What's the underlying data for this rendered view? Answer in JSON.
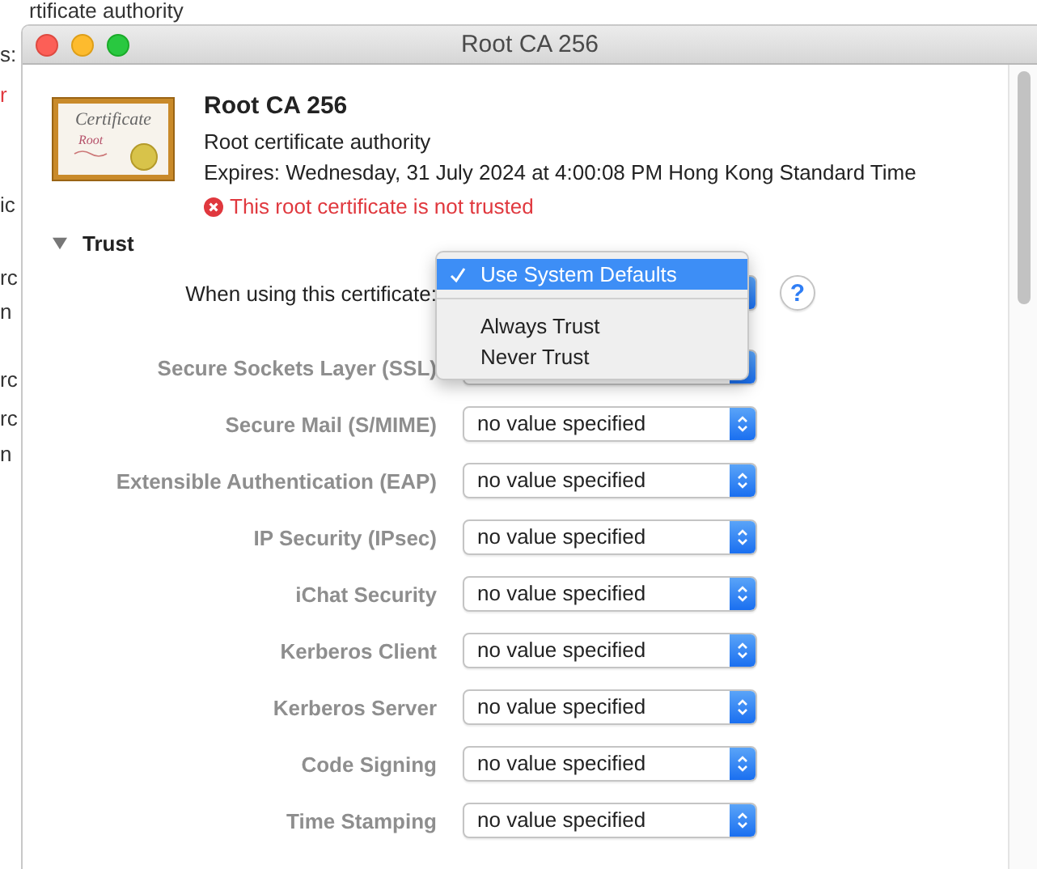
{
  "background_window": {
    "fragments": [
      {
        "text": "rtificate authority",
        "kind": "top"
      },
      {
        "text": "s:",
        "kind": "edge"
      },
      {
        "text": "r",
        "kind": "error"
      },
      {
        "text": "ic",
        "kind": "edge"
      },
      {
        "text": "rc",
        "kind": "edge"
      },
      {
        "text": "n",
        "kind": "edge"
      },
      {
        "text": "rc",
        "kind": "edge"
      },
      {
        "text": "rc",
        "kind": "edge"
      },
      {
        "text": "n",
        "kind": "edge"
      }
    ]
  },
  "window": {
    "title": "Root CA 256"
  },
  "certificate": {
    "icon_text": [
      "Certificate",
      "Root"
    ],
    "name": "Root CA 256",
    "type": "Root certificate authority",
    "expires": "Expires: Wednesday, 31 July 2024 at 4:00:08 PM Hong Kong Standard Time",
    "status": "This root certificate is not trusted"
  },
  "trust": {
    "label": "Trust",
    "expanded": true,
    "help": "?",
    "when_using_label": "When using this certificate:",
    "menu": [
      {
        "label": "Use System Defaults",
        "checked": true,
        "selected": true
      },
      {
        "label": "Always Trust",
        "checked": false,
        "selected": false
      },
      {
        "label": "Never Trust",
        "checked": false,
        "selected": false
      }
    ],
    "rows": [
      {
        "label": "Secure Sockets Layer (SSL)",
        "disabled": true
      },
      {
        "label": "Secure Mail (S/MIME)",
        "value": "no value specified",
        "disabled": true
      },
      {
        "label": "Extensible Authentication (EAP)",
        "value": "no value specified",
        "disabled": true
      },
      {
        "label": "IP Security (IPsec)",
        "value": "no value specified",
        "disabled": true
      },
      {
        "label": "iChat Security",
        "value": "no value specified",
        "disabled": true
      },
      {
        "label": "Kerberos Client",
        "value": "no value specified",
        "disabled": true
      },
      {
        "label": "Kerberos Server",
        "value": "no value specified",
        "disabled": true
      },
      {
        "label": "Code Signing",
        "value": "no value specified",
        "disabled": true
      },
      {
        "label": "Time Stamping",
        "value": "no value specified",
        "disabled": true
      }
    ]
  }
}
